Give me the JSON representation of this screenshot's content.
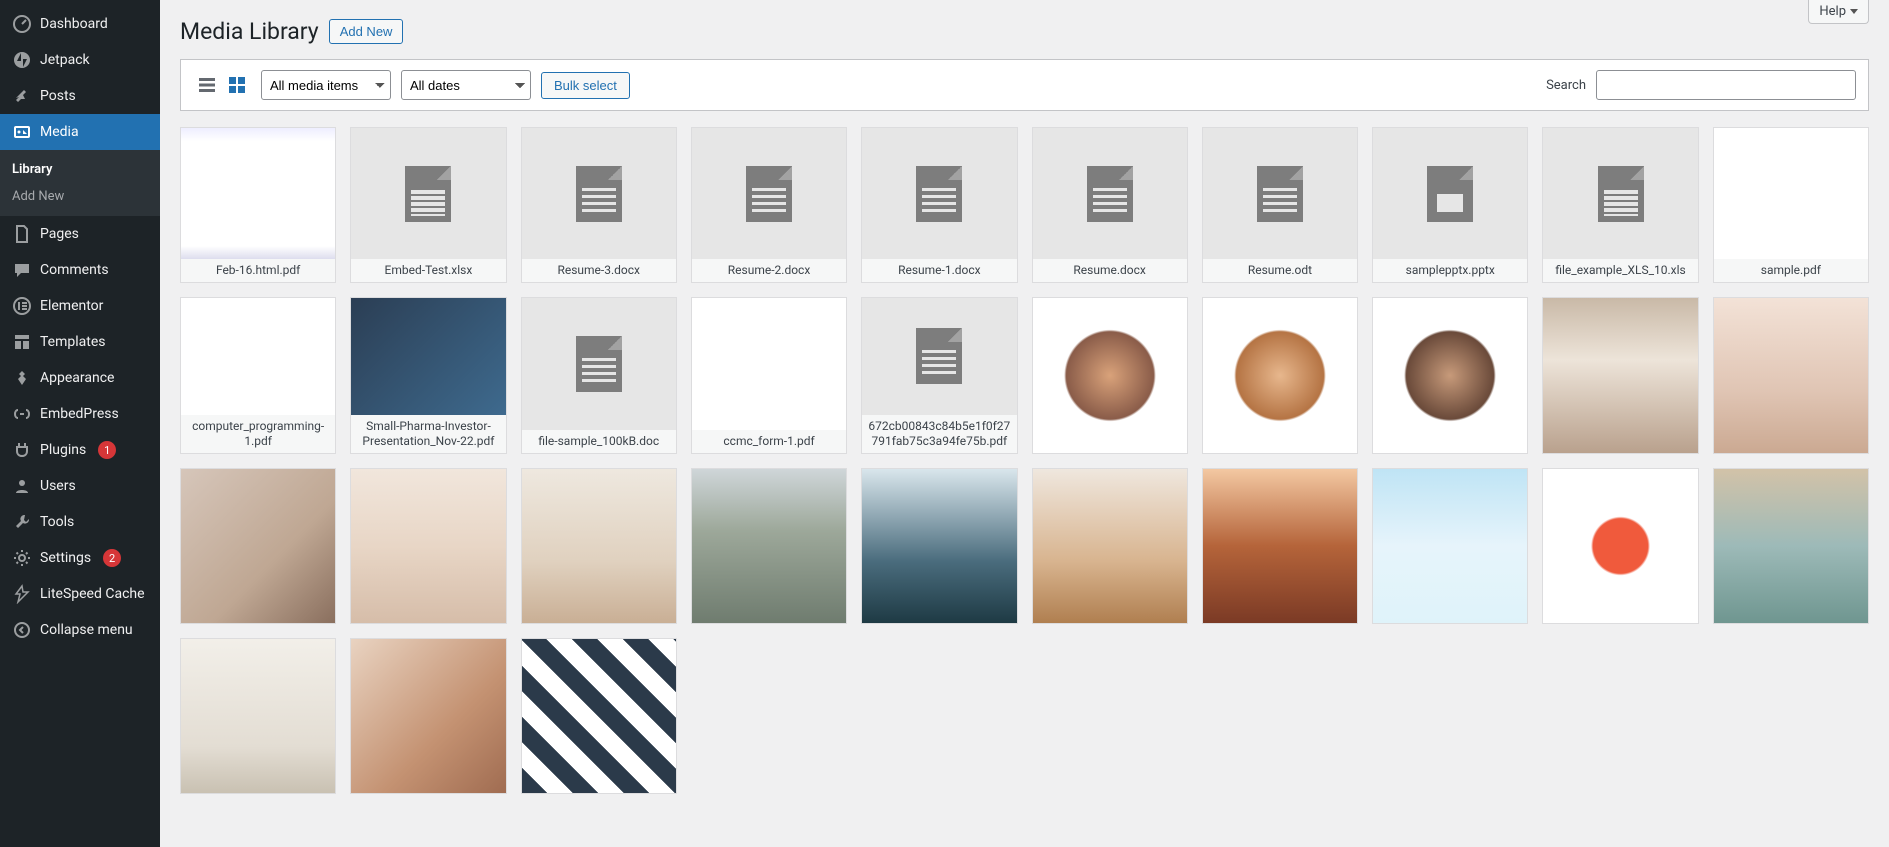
{
  "help": {
    "label": "Help"
  },
  "page": {
    "title": "Media Library",
    "add_new": "Add New"
  },
  "toolbar": {
    "filter_type": "All media items",
    "filter_date": "All dates",
    "bulk_select": "Bulk select",
    "search_label": "Search",
    "search_placeholder": ""
  },
  "sidebar": [
    {
      "icon": "dashboard",
      "label": "Dashboard"
    },
    {
      "icon": "jetpack",
      "label": "Jetpack"
    },
    {
      "icon": "pin",
      "label": "Posts"
    },
    {
      "icon": "media",
      "label": "Media",
      "active": true,
      "sub": [
        {
          "label": "Library",
          "current": true
        },
        {
          "label": "Add New"
        }
      ]
    },
    {
      "icon": "page",
      "label": "Pages"
    },
    {
      "icon": "comment",
      "label": "Comments"
    },
    {
      "icon": "elementor",
      "label": "Elementor"
    },
    {
      "icon": "templates",
      "label": "Templates"
    },
    {
      "icon": "appearance",
      "label": "Appearance"
    },
    {
      "icon": "embedpress",
      "label": "EmbedPress"
    },
    {
      "icon": "plugins",
      "label": "Plugins",
      "badge": "1"
    },
    {
      "icon": "users",
      "label": "Users"
    },
    {
      "icon": "tools",
      "label": "Tools"
    },
    {
      "icon": "settings",
      "label": "Settings",
      "badge": "2"
    },
    {
      "icon": "litespeed",
      "label": "LiteSpeed Cache"
    },
    {
      "icon": "collapse",
      "label": "Collapse menu"
    }
  ],
  "media": [
    {
      "type": "doc",
      "subtype": "pdf",
      "label": "Feb-16.html.pdf",
      "thumbKind": "preview",
      "bg": "linear-gradient(180deg,#eef,#fff 10%, #fff 90%, #dde)"
    },
    {
      "type": "doc",
      "subtype": "sheet",
      "label": "Embed-Test.xlsx"
    },
    {
      "type": "doc",
      "subtype": "doc",
      "label": "Resume-3.docx"
    },
    {
      "type": "doc",
      "subtype": "doc",
      "label": "Resume-2.docx"
    },
    {
      "type": "doc",
      "subtype": "doc",
      "label": "Resume-1.docx"
    },
    {
      "type": "doc",
      "subtype": "doc",
      "label": "Resume.docx"
    },
    {
      "type": "doc",
      "subtype": "doc",
      "label": "Resume.odt"
    },
    {
      "type": "doc",
      "subtype": "ppt",
      "label": "samplepptx.pptx"
    },
    {
      "type": "doc",
      "subtype": "sheet",
      "label": "file_example_XLS_10.xls"
    },
    {
      "type": "doc",
      "subtype": "pdf",
      "label": "sample.pdf",
      "thumbKind": "preview",
      "bg": "linear-gradient(#fff,#fff)"
    },
    {
      "type": "doc",
      "subtype": "pdf",
      "label": "computer_programming-1.pdf",
      "thumbKind": "preview",
      "bg": "linear-gradient(#fff,#fff)"
    },
    {
      "type": "doc",
      "subtype": "pdf",
      "label": "Small-Pharma-Investor-Presentation_Nov-22.pdf",
      "thumbKind": "preview",
      "bg": "linear-gradient(135deg,#2b3e54,#3e6a8e)"
    },
    {
      "type": "doc",
      "subtype": "doc",
      "label": "file-sample_100kB.doc"
    },
    {
      "type": "doc",
      "subtype": "pdf",
      "label": "ccmc_form-1.pdf",
      "thumbKind": "preview",
      "bg": "linear-gradient(#fff,#fff)"
    },
    {
      "type": "doc",
      "subtype": "pdf",
      "label": "672cb00843c84b5e1f0f27791fab75c3a94fe75b.pdf"
    },
    {
      "type": "image",
      "bg": "radial-gradient(circle at 50% 50%, #d9a27a 0%, #8a5c49 40%, #fff 42%)"
    },
    {
      "type": "image",
      "bg": "radial-gradient(circle at 50% 50%, #e7b78d 0%, #b57444 40%, #fff 42%)"
    },
    {
      "type": "image",
      "bg": "radial-gradient(circle at 50% 50%, #c79a7a 0%, #6a4a3a 40%, #fff 42%)"
    },
    {
      "type": "image",
      "bg": "linear-gradient(180deg,#c9b9a7,#ede4d9 40%,#b9a18d)"
    },
    {
      "type": "image",
      "bg": "linear-gradient(180deg,#f3e2d7,#e0c5b4 60%,#cba992)"
    },
    {
      "type": "image",
      "bg": "linear-gradient(135deg,#d6c6ba,#bfa793 60%,#8a6f5e)"
    },
    {
      "type": "image",
      "bg": "linear-gradient(180deg,#f1e6dc,#e8d6c6 50%,#d6bda9)"
    },
    {
      "type": "image",
      "bg": "linear-gradient(180deg,#eee8df,#e0d1bf 60%,#c9af95)"
    },
    {
      "type": "image",
      "bg": "linear-gradient(180deg,#cfd6d9,#9da89a 40%,#6f7c6f)"
    },
    {
      "type": "image",
      "bg": "linear-gradient(180deg,#d9e6ec,#4a6c7d 60%,#1e3a44)"
    },
    {
      "type": "image",
      "bg": "linear-gradient(180deg,#efe7de,#d8b48f 60%,#b07f50)"
    },
    {
      "type": "image",
      "bg": "linear-gradient(180deg,#f3c8a2,#b5643a 50%,#7b3a25)"
    },
    {
      "type": "image",
      "bg": "linear-gradient(180deg,#bfe4f5,#e6f4fb 50%,#dff3fa)"
    },
    {
      "type": "image",
      "bg": "radial-gradient(circle at 50% 50%, #f05a3c 0%, #f05a3c 25%, #fff 27%)"
    },
    {
      "type": "image",
      "bg": "linear-gradient(180deg,#d2c2a8,#9dbab8 50%,#6f9690)"
    },
    {
      "type": "image",
      "bg": "linear-gradient(180deg,#f2efe9,#e3ddd3 70%,#c9c1b2)"
    },
    {
      "type": "image",
      "bg": "linear-gradient(135deg,#e9d3c1,#c49272 60%,#a06c51)"
    },
    {
      "type": "image",
      "bg": "repeating-linear-gradient(45deg,#2b3a4a 0 18px,#fff 18px 36px)"
    }
  ]
}
